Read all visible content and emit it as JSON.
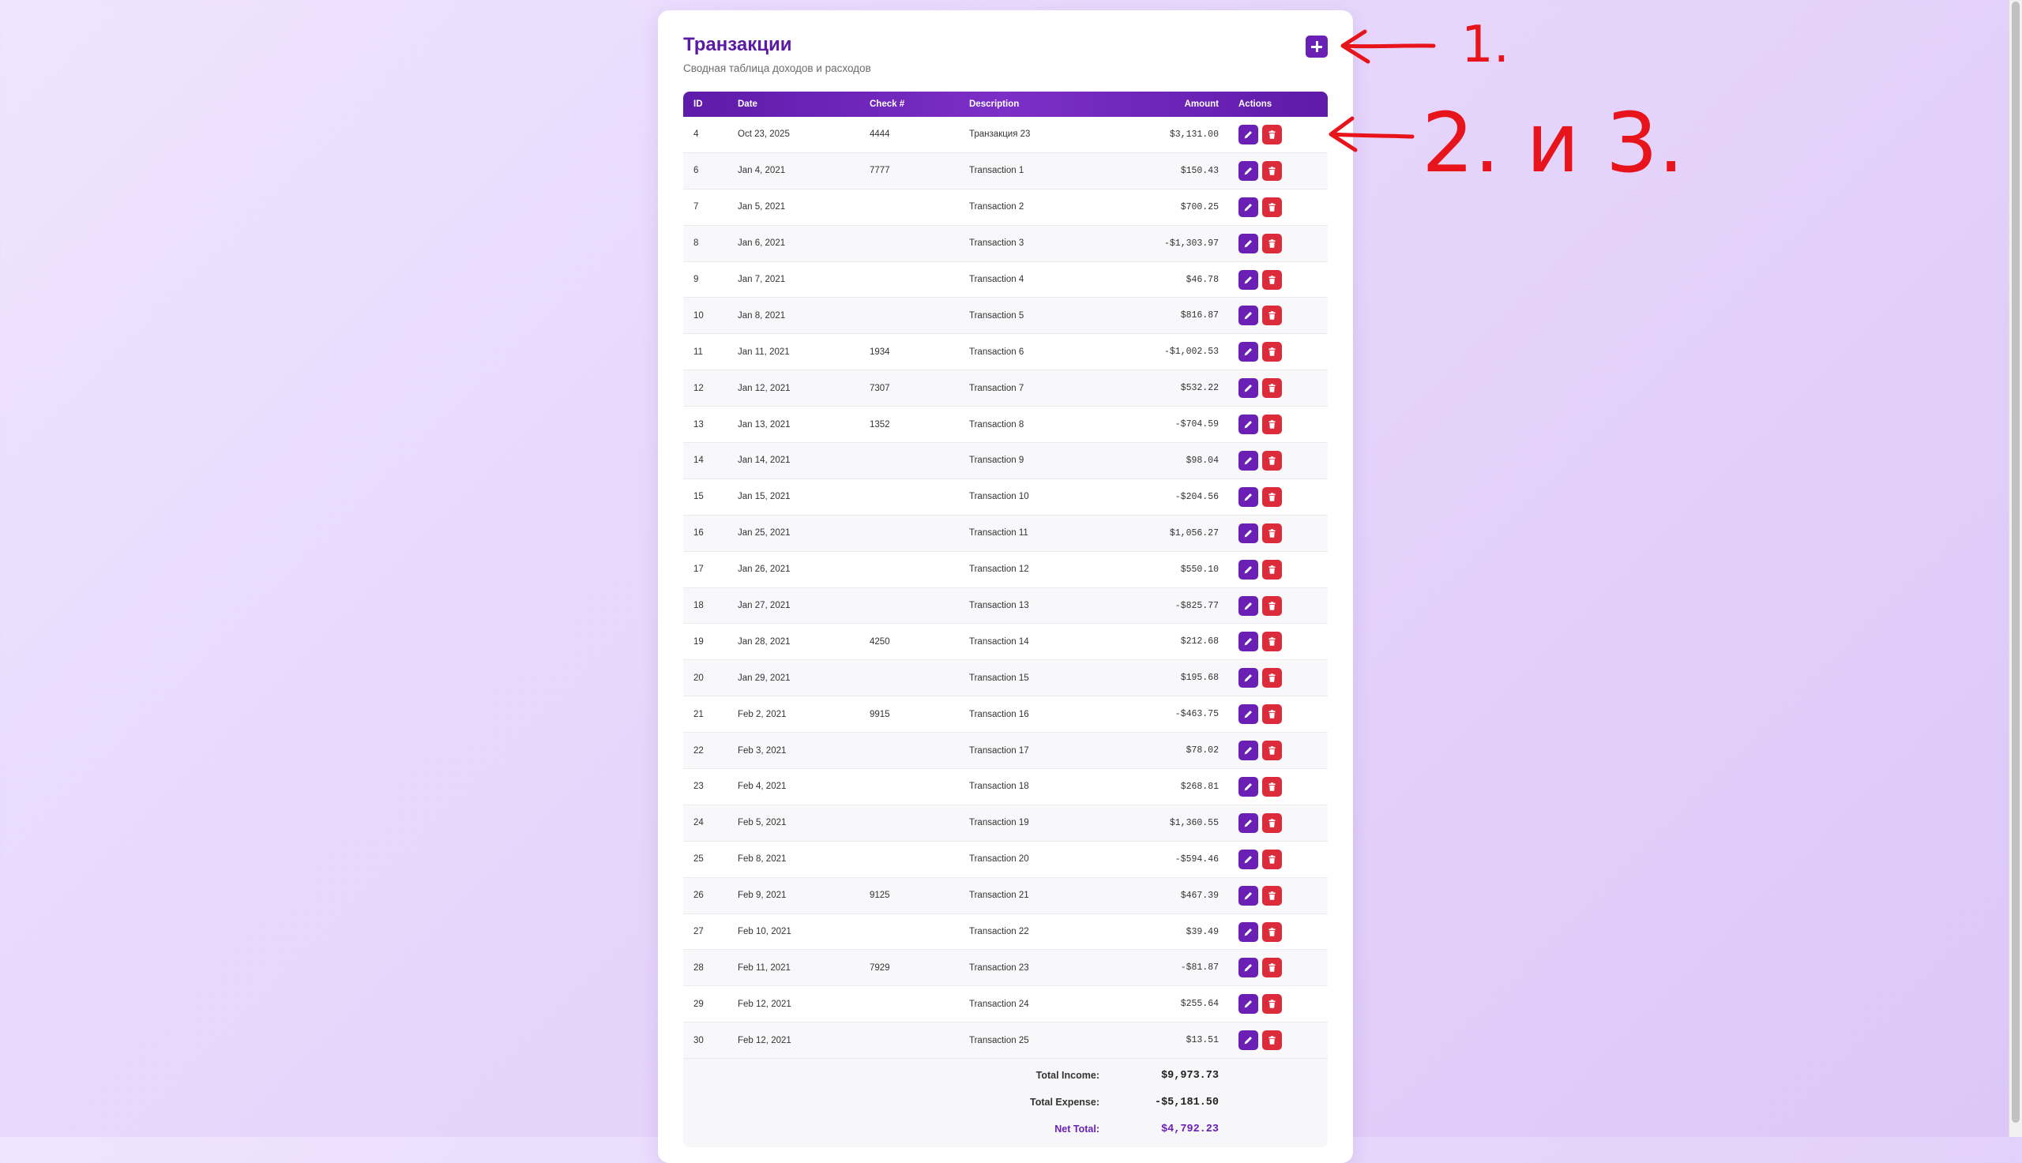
{
  "page": {
    "title": "Транзакции",
    "subtitle": "Сводная таблица доходов и расходов"
  },
  "table": {
    "columns": {
      "id": "ID",
      "date": "Date",
      "check": "Check #",
      "description": "Description",
      "amount": "Amount",
      "actions": "Actions"
    },
    "rows": [
      {
        "id": "4",
        "date": "Oct 23, 2025",
        "check": "4444",
        "description": "Транзакция 23",
        "amount": "$3,131.00"
      },
      {
        "id": "6",
        "date": "Jan 4, 2021",
        "check": "7777",
        "description": "Transaction 1",
        "amount": "$150.43"
      },
      {
        "id": "7",
        "date": "Jan 5, 2021",
        "check": "",
        "description": "Transaction 2",
        "amount": "$700.25"
      },
      {
        "id": "8",
        "date": "Jan 6, 2021",
        "check": "",
        "description": "Transaction 3",
        "amount": "-$1,303.97"
      },
      {
        "id": "9",
        "date": "Jan 7, 2021",
        "check": "",
        "description": "Transaction 4",
        "amount": "$46.78"
      },
      {
        "id": "10",
        "date": "Jan 8, 2021",
        "check": "",
        "description": "Transaction 5",
        "amount": "$816.87"
      },
      {
        "id": "11",
        "date": "Jan 11, 2021",
        "check": "1934",
        "description": "Transaction 6",
        "amount": "-$1,002.53"
      },
      {
        "id": "12",
        "date": "Jan 12, 2021",
        "check": "7307",
        "description": "Transaction 7",
        "amount": "$532.22"
      },
      {
        "id": "13",
        "date": "Jan 13, 2021",
        "check": "1352",
        "description": "Transaction 8",
        "amount": "-$704.59"
      },
      {
        "id": "14",
        "date": "Jan 14, 2021",
        "check": "",
        "description": "Transaction 9",
        "amount": "$98.04"
      },
      {
        "id": "15",
        "date": "Jan 15, 2021",
        "check": "",
        "description": "Transaction 10",
        "amount": "-$204.56"
      },
      {
        "id": "16",
        "date": "Jan 25, 2021",
        "check": "",
        "description": "Transaction 11",
        "amount": "$1,056.27"
      },
      {
        "id": "17",
        "date": "Jan 26, 2021",
        "check": "",
        "description": "Transaction 12",
        "amount": "$550.10"
      },
      {
        "id": "18",
        "date": "Jan 27, 2021",
        "check": "",
        "description": "Transaction 13",
        "amount": "-$825.77"
      },
      {
        "id": "19",
        "date": "Jan 28, 2021",
        "check": "4250",
        "description": "Transaction 14",
        "amount": "$212.68"
      },
      {
        "id": "20",
        "date": "Jan 29, 2021",
        "check": "",
        "description": "Transaction 15",
        "amount": "$195.68"
      },
      {
        "id": "21",
        "date": "Feb 2, 2021",
        "check": "9915",
        "description": "Transaction 16",
        "amount": "-$463.75"
      },
      {
        "id": "22",
        "date": "Feb 3, 2021",
        "check": "",
        "description": "Transaction 17",
        "amount": "$78.02"
      },
      {
        "id": "23",
        "date": "Feb 4, 2021",
        "check": "",
        "description": "Transaction 18",
        "amount": "$268.81"
      },
      {
        "id": "24",
        "date": "Feb 5, 2021",
        "check": "",
        "description": "Transaction 19",
        "amount": "$1,360.55"
      },
      {
        "id": "25",
        "date": "Feb 8, 2021",
        "check": "",
        "description": "Transaction 20",
        "amount": "-$594.46"
      },
      {
        "id": "26",
        "date": "Feb 9, 2021",
        "check": "9125",
        "description": "Transaction 21",
        "amount": "$467.39"
      },
      {
        "id": "27",
        "date": "Feb 10, 2021",
        "check": "",
        "description": "Transaction 22",
        "amount": "$39.49"
      },
      {
        "id": "28",
        "date": "Feb 11, 2021",
        "check": "7929",
        "description": "Transaction 23",
        "amount": "-$81.87"
      },
      {
        "id": "29",
        "date": "Feb 12, 2021",
        "check": "",
        "description": "Transaction 24",
        "amount": "$255.64"
      },
      {
        "id": "30",
        "date": "Feb 12, 2021",
        "check": "",
        "description": "Transaction 25",
        "amount": "$13.51"
      }
    ],
    "row_actions": {
      "edit_icon": "pencil-icon",
      "delete_icon": "trash-icon"
    }
  },
  "totals": {
    "income_label": "Total Income:",
    "income_value": "$9,973.73",
    "expense_label": "Total Expense:",
    "expense_value": "-$5,181.50",
    "net_label": "Net Total:",
    "net_value": "$4,792.23"
  },
  "annotations": {
    "label_1": "1.",
    "label_2": "2. и 3.",
    "color": "#e8141c"
  },
  "colors": {
    "accent": "#6a1fb5",
    "delete": "#dc2c3b",
    "title": "#5b1aa3"
  }
}
